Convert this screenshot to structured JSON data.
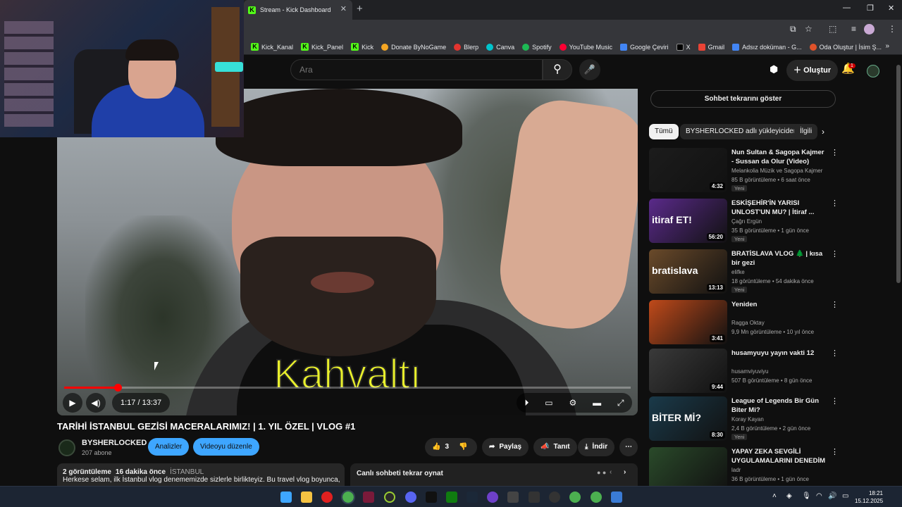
{
  "browser": {
    "tab_title": "Stream - Kick Dashboard",
    "bookmarks": [
      "Kick_Kanal",
      "Kick_Panel",
      "Kick",
      "Donate ByNoGame",
      "Blerp",
      "Canva",
      "Spotify",
      "YouTube Music",
      "Google Çeviri",
      "X",
      "Gmail",
      "Adsız doküman - G...",
      "Oda Oluştur | İsim Ş..."
    ]
  },
  "youtube": {
    "search_placeholder": "Ara",
    "create_label": "Oluştur",
    "notif_count": "1"
  },
  "player": {
    "subtitle": "Kahvaltı",
    "time": "1:17 / 13:37",
    "progress": 0.094
  },
  "video": {
    "title": "TARİHİ İSTANBUL GEZİSİ MACERALARIMIZ! | 1. YIL ÖZEL | VLOG #1",
    "channel": "BYSHERLOCKED",
    "subs": "207 abone",
    "analytics_label": "Analizler",
    "edit_label": "Videoyu düzenle",
    "likes": "3",
    "share_label": "Paylaş",
    "promote_label": "Tanıt",
    "download_label": "İndir",
    "views": "2 görüntüleme",
    "age": "16 dakika önce",
    "location": "İSTANBUL",
    "description": "Herkese selam, ilk İstanbul vlog denememizde sizlerle birlikteyiz. Bu travel vlog boyunca,",
    "chat_replay_label": "Canlı sohbeti tekrar oynat"
  },
  "sidebar": {
    "show_chat": "Sohbet tekrarını göster",
    "chips": [
      "Tümü",
      "BYSHERLOCKED adlı yükleyiciden",
      "İlgili"
    ],
    "recs": [
      {
        "title": "Nun Sultan & Sagopa Kajmer - Sussan da Olur (Video)",
        "channel": "Melankolia Müzik ve Sagopa Kajmer",
        "stats": "85 B görüntüleme • 6 saat önce",
        "badge": "Yeni",
        "duration": "4:32",
        "color": "#1c1c1c",
        "thumb_text": ""
      },
      {
        "title": "ESKİŞEHİR'İN YARISI UNLOST'UN MU? | İtiraf ...",
        "channel": "Çağrı Ergün",
        "stats": "35 B görüntüleme • 1 gün önce",
        "badge": "Yeni",
        "duration": "56:20",
        "color": "#5a2a8a",
        "thumb_text": "itiraf ET!"
      },
      {
        "title": "BRATİSLAVA VLOG 🌲 | kısa bir gezi",
        "channel": "elifke",
        "stats": "18 görüntüleme • 54 dakika önce",
        "badge": "Yeni",
        "duration": "13:13",
        "color": "#6a4a2a",
        "thumb_text": "bratislava"
      },
      {
        "title": "Yeniden",
        "channel": "Ragga Oktay",
        "stats": "9,9 Mn görüntüleme • 10 yıl önce",
        "badge": "",
        "duration": "3:41",
        "color": "#c04a1a",
        "thumb_text": ""
      },
      {
        "title": "husamyuyu yayın vakti 12",
        "channel": "husamviyuviyu",
        "stats": "507 B görüntüleme • 8 gün önce",
        "badge": "",
        "duration": "9:44",
        "color": "#3a3a3a",
        "thumb_text": ""
      },
      {
        "title": "League of Legends Bir Gün Biter Mi?",
        "channel": "Koray Kayan",
        "stats": "2,4 B görüntüleme • 2 gün önce",
        "badge": "Yeni",
        "duration": "8:30",
        "color": "#1a3a4a",
        "thumb_text": "BİTER Mİ?"
      },
      {
        "title": "YAPAY ZEKA SEVGİLİ UYGULAMALARINI DENEDİM",
        "channel": "ladr",
        "stats": "36 B görüntüleme • 1 gün önce",
        "badge": "",
        "duration": "",
        "color": "#2a4a2a",
        "thumb_text": ""
      }
    ]
  },
  "taskbar": {
    "time": "18:21",
    "date": "15.12.2025"
  },
  "colors": {
    "accent_red": "#ff0000",
    "accent_blue": "#3ea6ff",
    "kick_green": "#53fc18"
  }
}
